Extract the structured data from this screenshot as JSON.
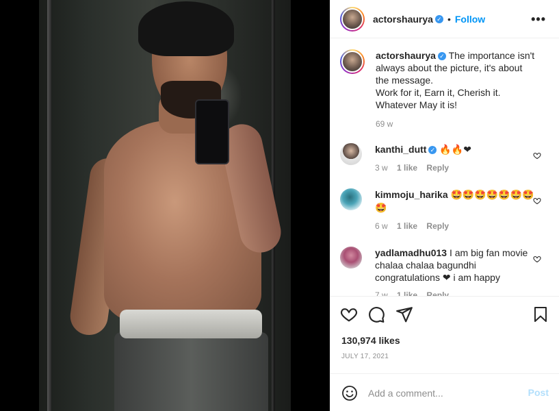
{
  "post": {
    "username": "actorshaurya",
    "verified_mark": "✓",
    "dot": "•",
    "follow_label": "Follow",
    "more_label": "•••"
  },
  "caption": {
    "username": "actorshaurya",
    "text_line1": "The importance isn't always about the picture, it's about the message.",
    "text_line2": "Work for it, Earn it, Cherish it.",
    "text_line3": "Whatever May it is!",
    "age": "69 w"
  },
  "comments": [
    {
      "username": "kanthi_dutt",
      "verified": true,
      "text": "🔥🔥❤",
      "age": "3 w",
      "likes": "1 like",
      "reply": "Reply"
    },
    {
      "username": "kimmoju_harika",
      "verified": false,
      "text": "🤩🤩🤩🤩🤩🤩🤩🤩",
      "age": "6 w",
      "likes": "1 like",
      "reply": "Reply"
    },
    {
      "username": "yadlamadhu013",
      "verified": false,
      "text": "I am big fan movie chalaa chalaa bagundhi congratulations ❤ i am happy",
      "age": "7 w",
      "likes": "1 like",
      "reply": "Reply"
    }
  ],
  "stats": {
    "likes": "130,974 likes",
    "date": "JULY 17, 2021"
  },
  "composer": {
    "placeholder": "Add a comment...",
    "post_label": "Post"
  },
  "colors": {
    "accent": "#0095f6",
    "verified": "#3897f0",
    "muted": "#8e8e8e",
    "post_disabled": "#b2dffc"
  }
}
